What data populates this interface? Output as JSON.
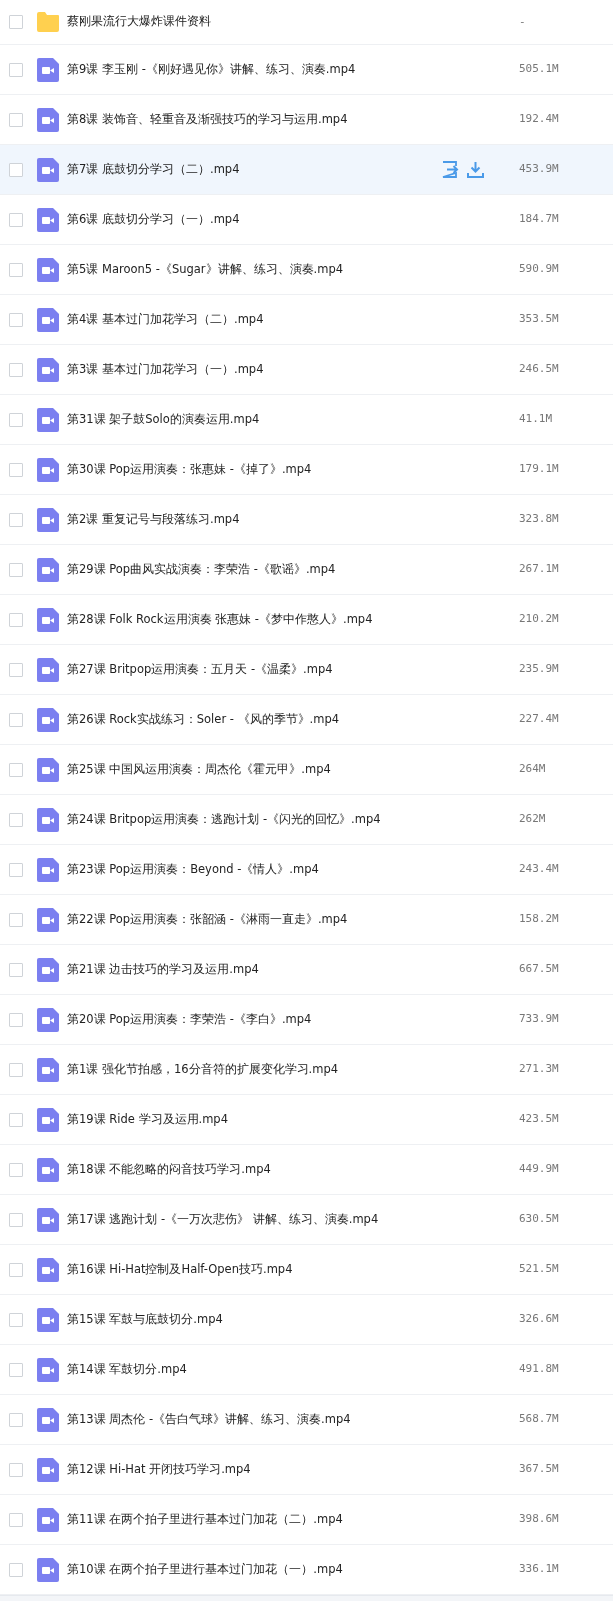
{
  "files": [
    {
      "kind": "folder",
      "name": "蔡刚果流行大爆炸课件资料",
      "size": "-",
      "checked": false,
      "highlighted": false
    },
    {
      "kind": "video",
      "name": "第9课 李玉刚 -《刚好遇见你》讲解、练习、演奏.mp4",
      "size": "505.1M",
      "checked": false,
      "highlighted": false
    },
    {
      "kind": "video",
      "name": "第8课 装饰音、轻重音及渐强技巧的学习与运用.mp4",
      "size": "192.4M",
      "checked": false,
      "highlighted": false
    },
    {
      "kind": "video",
      "name": "第7课 底鼓切分学习（二）.mp4",
      "size": "453.9M",
      "checked": false,
      "highlighted": true
    },
    {
      "kind": "video",
      "name": "第6课 底鼓切分学习（一）.mp4",
      "size": "184.7M",
      "checked": false,
      "highlighted": false
    },
    {
      "kind": "video",
      "name": "第5课 Maroon5 -《Sugar》讲解、练习、演奏.mp4",
      "size": "590.9M",
      "checked": false,
      "highlighted": false
    },
    {
      "kind": "video",
      "name": "第4课 基本过门加花学习（二）.mp4",
      "size": "353.5M",
      "checked": false,
      "highlighted": false
    },
    {
      "kind": "video",
      "name": "第3课 基本过门加花学习（一）.mp4",
      "size": "246.5M",
      "checked": false,
      "highlighted": false
    },
    {
      "kind": "video",
      "name": "第31课 架子鼓Solo的演奏运用.mp4",
      "size": "41.1M",
      "checked": false,
      "highlighted": false
    },
    {
      "kind": "video",
      "name": "第30课 Pop运用演奏：张惠妹 -《掉了》.mp4",
      "size": "179.1M",
      "checked": false,
      "highlighted": false
    },
    {
      "kind": "video",
      "name": "第2课 重复记号与段落练习.mp4",
      "size": "323.8M",
      "checked": false,
      "highlighted": false
    },
    {
      "kind": "video",
      "name": "第29课 Pop曲风实战演奏：李荣浩 -《歌谣》.mp4",
      "size": "267.1M",
      "checked": false,
      "highlighted": false
    },
    {
      "kind": "video",
      "name": "第28课 Folk Rock运用演奏 张惠妹 -《梦中作憨人》.mp4",
      "size": "210.2M",
      "checked": false,
      "highlighted": false
    },
    {
      "kind": "video",
      "name": "第27课 Britpop运用演奏：五月天 -《温柔》.mp4",
      "size": "235.9M",
      "checked": false,
      "highlighted": false
    },
    {
      "kind": "video",
      "name": "第26课 Rock实战练习：Soler - 《风的季节》.mp4",
      "size": "227.4M",
      "checked": false,
      "highlighted": false
    },
    {
      "kind": "video",
      "name": "第25课 中国风运用演奏：周杰伦《霍元甲》.mp4",
      "size": "264M",
      "checked": false,
      "highlighted": false
    },
    {
      "kind": "video",
      "name": "第24课 Britpop运用演奏：逃跑计划 -《闪光的回忆》.mp4",
      "size": "262M",
      "checked": false,
      "highlighted": false
    },
    {
      "kind": "video",
      "name": "第23课 Pop运用演奏：Beyond -《情人》.mp4",
      "size": "243.4M",
      "checked": false,
      "highlighted": false
    },
    {
      "kind": "video",
      "name": "第22课 Pop运用演奏：张韶涵 -《淋雨一直走》.mp4",
      "size": "158.2M",
      "checked": false,
      "highlighted": false
    },
    {
      "kind": "video",
      "name": "第21课 边击技巧的学习及运用.mp4",
      "size": "667.5M",
      "checked": false,
      "highlighted": false
    },
    {
      "kind": "video",
      "name": "第20课 Pop运用演奏：李荣浩 -《李白》.mp4",
      "size": "733.9M",
      "checked": false,
      "highlighted": false
    },
    {
      "kind": "video",
      "name": "第1课 强化节拍感，16分音符的扩展变化学习.mp4",
      "size": "271.3M",
      "checked": false,
      "highlighted": false
    },
    {
      "kind": "video",
      "name": "第19课 Ride 学习及运用.mp4",
      "size": "423.5M",
      "checked": false,
      "highlighted": false
    },
    {
      "kind": "video",
      "name": "第18课 不能忽略的闷音技巧学习.mp4",
      "size": "449.9M",
      "checked": false,
      "highlighted": false
    },
    {
      "kind": "video",
      "name": "第17课 逃跑计划 -《一万次悲伤》 讲解、练习、演奏.mp4",
      "size": "630.5M",
      "checked": false,
      "highlighted": false
    },
    {
      "kind": "video",
      "name": "第16课 Hi-Hat控制及Half-Open技巧.mp4",
      "size": "521.5M",
      "checked": false,
      "highlighted": false
    },
    {
      "kind": "video",
      "name": "第15课 军鼓与底鼓切分.mp4",
      "size": "326.6M",
      "checked": false,
      "highlighted": false
    },
    {
      "kind": "video",
      "name": "第14课 军鼓切分.mp4",
      "size": "491.8M",
      "checked": false,
      "highlighted": false
    },
    {
      "kind": "video",
      "name": "第13课 周杰伦 -《告白气球》讲解、练习、演奏.mp4",
      "size": "568.7M",
      "checked": false,
      "highlighted": false
    },
    {
      "kind": "video",
      "name": "第12课 Hi-Hat 开闭技巧学习.mp4",
      "size": "367.5M",
      "checked": false,
      "highlighted": false
    },
    {
      "kind": "video",
      "name": "第11课 在两个拍子里进行基本过门加花（二）.mp4",
      "size": "398.6M",
      "checked": false,
      "highlighted": false
    },
    {
      "kind": "video",
      "name": "第10课 在两个拍子里进行基本过门加花（一）.mp4",
      "size": "336.1M",
      "checked": false,
      "highlighted": false
    }
  ]
}
